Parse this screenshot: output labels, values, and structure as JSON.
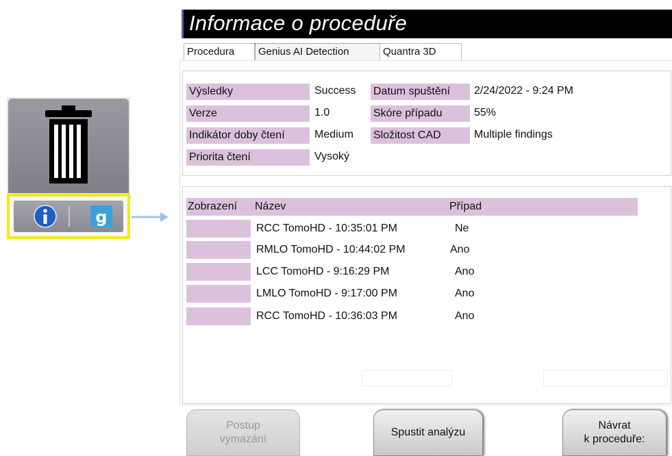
{
  "dialog": {
    "title": "Informace o proceduře",
    "tabs": [
      "Procedura",
      "Genius AI Detection",
      "Quantra 3D"
    ],
    "active_tab": "Genius AI Detection"
  },
  "summary": {
    "results_label": "Výsledky",
    "results_value": "Success",
    "version_label": "Verze",
    "version_value": "1.0",
    "read_time_label": "Indikátor doby čtení",
    "read_time_value": "Medium",
    "priority_label": "Priorita čtení",
    "priority_value": "Vysoký",
    "start_date_label": "Datum spuštění",
    "start_date_value": "2/24/2022 - 9:24 PM",
    "case_score_label": "Skóre případu",
    "case_score_value": "55%",
    "cad_label": "Složitost CAD",
    "cad_value": "Multiple findings"
  },
  "views_table": {
    "headers": [
      "Zobrazení",
      "Název",
      "Případ"
    ],
    "rows": [
      {
        "name": "RCC TomoHD - 10:35:01 PM",
        "case": "Ne"
      },
      {
        "name": "RMLO TomoHD - 10:44:02 PM",
        "case": "Ano"
      },
      {
        "name": "LCC TomoHD - 9:16:29 PM",
        "case": "Ano"
      },
      {
        "name": "LMLO TomoHD - 9:17:00 PM",
        "case": "Ano"
      },
      {
        "name": "RCC TomoHD - 10:36:03 PM",
        "case": "Ano"
      }
    ]
  },
  "buttons": {
    "clear_line1": "Postup",
    "clear_line2": "vymazání",
    "run_analysis": "Spustit analýzu",
    "return_line1": "Návrat",
    "return_line2": "k proceduře:"
  },
  "icons": {
    "trash": "trash-icon",
    "info": "info-icon",
    "genius": "genius-g-icon",
    "arrow": "arrow-right-icon"
  },
  "colors": {
    "label_bg": "#dcc1dc",
    "title_bg": "#000000",
    "highlight": "#f2ea1a",
    "info_blue": "#1f5fc4",
    "genius_blue": "#3aa2d8"
  }
}
